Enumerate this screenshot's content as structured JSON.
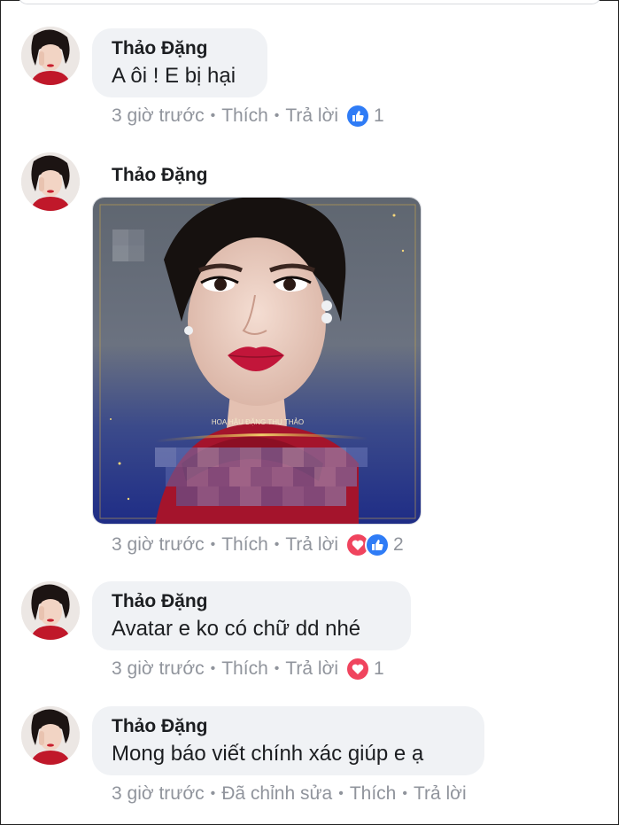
{
  "comments": [
    {
      "author": "Thảo Đặng",
      "text": "A ôi ! E bị hại",
      "time": "3 giờ trước",
      "like_label": "Thích",
      "reply_label": "Trả lời",
      "reaction_count": "1",
      "reactions": [
        "like-icon"
      ]
    },
    {
      "author": "Thảo Đặng",
      "image_caption": "HOA HẬU ĐẶNG THU THẢO",
      "time": "3 giờ trước",
      "like_label": "Thích",
      "reply_label": "Trả lời",
      "reaction_count": "2",
      "reactions": [
        "love-icon",
        "like-icon"
      ]
    },
    {
      "author": "Thảo Đặng",
      "text": "Avatar e ko có chữ dd nhé",
      "time": "3 giờ trước",
      "like_label": "Thích",
      "reply_label": "Trả lời",
      "reaction_count": "1",
      "reactions": [
        "love-icon"
      ]
    },
    {
      "author": "Thảo Đặng",
      "text": "Mong báo viết chính xác giúp e ạ",
      "time": "3 giờ trước",
      "edited_label": "Đã chỉnh sửa",
      "like_label": "Thích",
      "reply_label": "Trả lời"
    }
  ],
  "colors": {
    "like": "#2f7cf6",
    "love": "#f0445e",
    "bubble": "#f0f2f5",
    "meta": "#90949c"
  }
}
